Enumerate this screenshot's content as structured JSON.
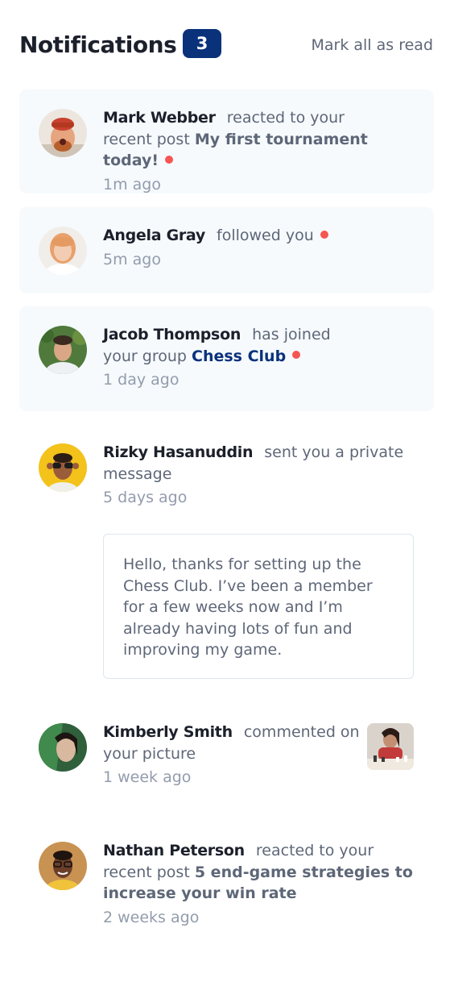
{
  "header": {
    "title": "Notifications",
    "badge_count": "3",
    "mark_all_label": "Mark all as read"
  },
  "notifications": [
    {
      "name": "Mark Webber",
      "action": "reacted to your recent post",
      "post": "My first tournament today!",
      "time": "1m ago",
      "unread": true
    },
    {
      "name": "Angela Gray",
      "action": "followed you",
      "time": "5m ago",
      "unread": true
    },
    {
      "name": "Jacob Thompson",
      "action": "has joined your group",
      "group": "Chess Club",
      "time": "1 day ago",
      "unread": true
    },
    {
      "name": "Rizky Hasanuddin",
      "action": "sent you a private message",
      "time": "5 days ago",
      "message": "Hello, thanks for setting up the Chess Club. I’ve been a member for a few weeks now and I’m already having lots of fun and improving my game.",
      "unread": false
    },
    {
      "name": "Kimberly Smith",
      "action": "commented on your picture",
      "time": "1 week ago",
      "unread": false
    },
    {
      "name": "Nathan Peterson",
      "action": "reacted to your recent post",
      "post": "5 end-game strategies to increase your win rate",
      "time": "2 weeks ago",
      "unread": false
    }
  ],
  "colors": {
    "unread_bg": "#f6fafd",
    "accent_blue": "#0a327b",
    "unread_dot": "#f65552",
    "text_dark": "#1c202b",
    "text_grey": "#5e6778",
    "text_light": "#939cad"
  }
}
